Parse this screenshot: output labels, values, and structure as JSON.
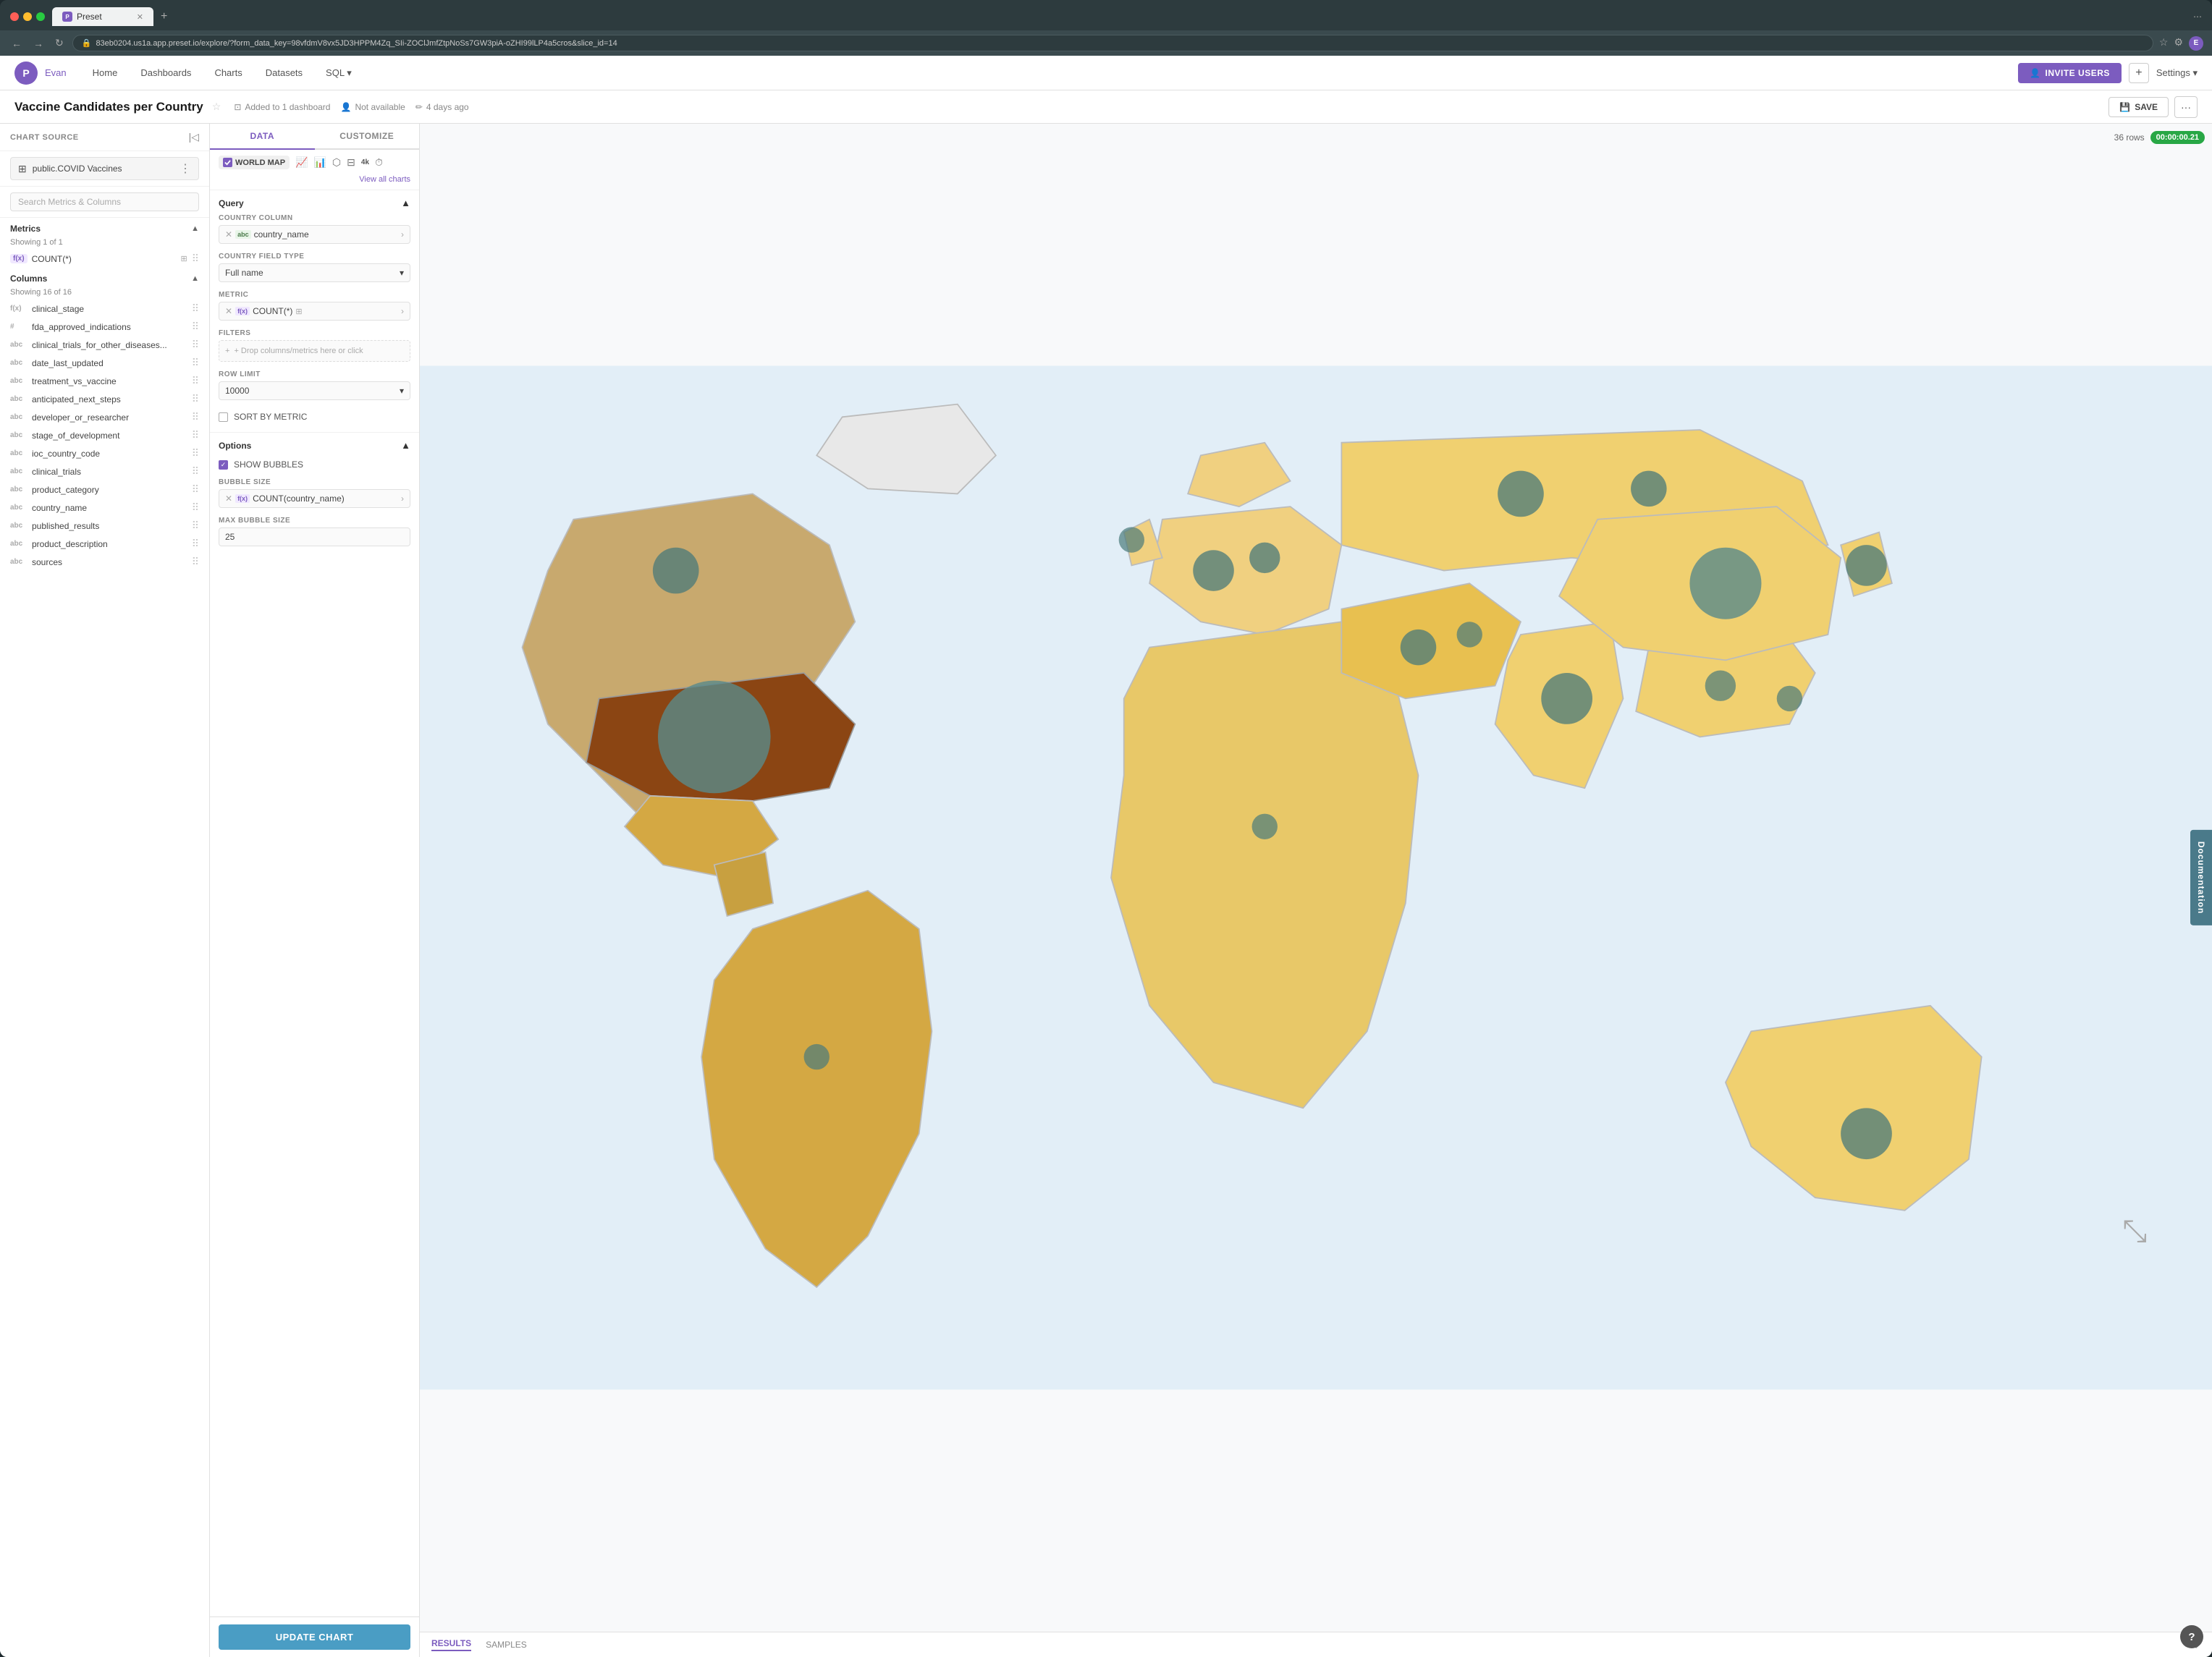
{
  "browser": {
    "tab_label": "Preset",
    "url": "83eb0204.us1a.app.preset.io/explore/?form_data_key=98vfdmV8vx5JD3HPPM4Zq_SIi-ZOClJmfZtpNoSs7GW3piA-oZHI99lLP4a5cros&slice_id=14",
    "new_tab_icon": "+",
    "back_icon": "←",
    "forward_icon": "→",
    "refresh_icon": "↻"
  },
  "nav": {
    "user": "Evan",
    "links": [
      "Home",
      "Dashboards",
      "Charts",
      "Datasets",
      "SQL ▾"
    ],
    "invite_label": "INVITE USERS",
    "settings_label": "Settings ▾"
  },
  "chart": {
    "title": "Vaccine Candidates per Country",
    "added_to": "Added to 1 dashboard",
    "availability": "Not available",
    "time_ago": "4 days ago",
    "save_label": "SAVE",
    "rows": "36 rows",
    "timer": "00:00:00.21"
  },
  "sidebar": {
    "source_label": "Chart Source",
    "source_name": "public.COVID Vaccines",
    "search_placeholder": "Search Metrics & Columns",
    "metrics_label": "Metrics",
    "metrics_showing": "Showing 1 of 1",
    "metric_item": "COUNT(*)",
    "columns_label": "Columns",
    "columns_showing": "Showing 16 of 16",
    "columns": [
      {
        "type": "f(x)",
        "name": "clinical_stage"
      },
      {
        "type": "#",
        "name": "fda_approved_indications"
      },
      {
        "type": "abc",
        "name": "clinical_trials_for_other_diseases..."
      },
      {
        "type": "abc",
        "name": "date_last_updated"
      },
      {
        "type": "abc",
        "name": "treatment_vs_vaccine"
      },
      {
        "type": "abc",
        "name": "anticipated_next_steps"
      },
      {
        "type": "abc",
        "name": "developer_or_researcher"
      },
      {
        "type": "abc",
        "name": "stage_of_development"
      },
      {
        "type": "abc",
        "name": "ioc_country_code"
      },
      {
        "type": "abc",
        "name": "clinical_trials"
      },
      {
        "type": "abc",
        "name": "product_category"
      },
      {
        "type": "abc",
        "name": "country_name"
      },
      {
        "type": "abc",
        "name": "published_results"
      },
      {
        "type": "abc",
        "name": "product_description"
      },
      {
        "type": "abc",
        "name": "sources"
      }
    ]
  },
  "panel": {
    "tab_data": "DATA",
    "tab_customize": "CUSTOMIZE",
    "chart_type_label": "WORLD MAP",
    "view_all_charts": "View all charts",
    "query_title": "Query",
    "country_column_label": "COUNTRY COLUMN",
    "country_column_value": "country_name",
    "country_field_type_label": "COUNTRY FIELD TYPE",
    "country_field_type_value": "Full name",
    "metric_label": "METRIC",
    "metric_value": "COUNT(*)",
    "filters_label": "FILTERS",
    "filters_placeholder": "+ Drop columns/metrics here or click",
    "row_limit_label": "ROW LIMIT",
    "row_limit_value": "10000",
    "sort_by_metric_label": "SORT BY METRIC",
    "options_title": "Options",
    "show_bubbles_label": "SHOW BUBBLES",
    "bubble_size_label": "BUBBLE SIZE",
    "bubble_size_value": "COUNT(country_name)",
    "max_bubble_size_label": "MAX BUBBLE SIZE",
    "max_bubble_size_value": "25",
    "update_label": "UPDATE CHART"
  },
  "results": {
    "results_tab": "RESULTS",
    "samples_tab": "SAMPLES"
  },
  "doc_sidebar": "Documentation",
  "help": "?"
}
